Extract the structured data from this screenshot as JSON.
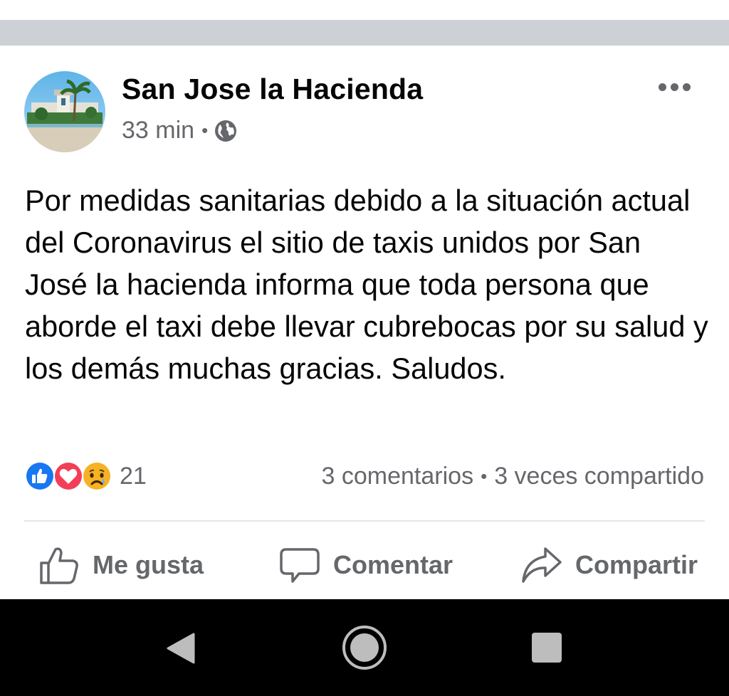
{
  "post": {
    "page_name": "San Jose la Hacienda",
    "timestamp": "33 min",
    "separator": "•",
    "privacy_icon": "globe-icon",
    "body": "Por medidas sanitarias debido a la situación actual del Coronavirus el sitio de taxis unidos por San José la hacienda informa que toda persona que aborde el taxi debe llevar cubrebocas por su salud y los demás muchas gracias. Saludos."
  },
  "reactions": {
    "icons": [
      "like-icon",
      "love-icon",
      "sad-icon"
    ],
    "count": "21"
  },
  "stats": {
    "comments": "3 comentarios",
    "separator": "•",
    "shares": "3 veces compartido"
  },
  "actions": {
    "like": "Me gusta",
    "comment": "Comentar",
    "share": "Compartir"
  },
  "colors": {
    "text_primary": "#050505",
    "text_secondary": "#65676b",
    "like_blue": "#1877f2",
    "love_red": "#f33e58",
    "sad_yellow": "#f7b125",
    "separator_band": "#cdd0d5",
    "nav_bar": "#000000"
  },
  "system_nav": {
    "icons": [
      "back-icon",
      "home-icon",
      "recents-icon"
    ]
  }
}
